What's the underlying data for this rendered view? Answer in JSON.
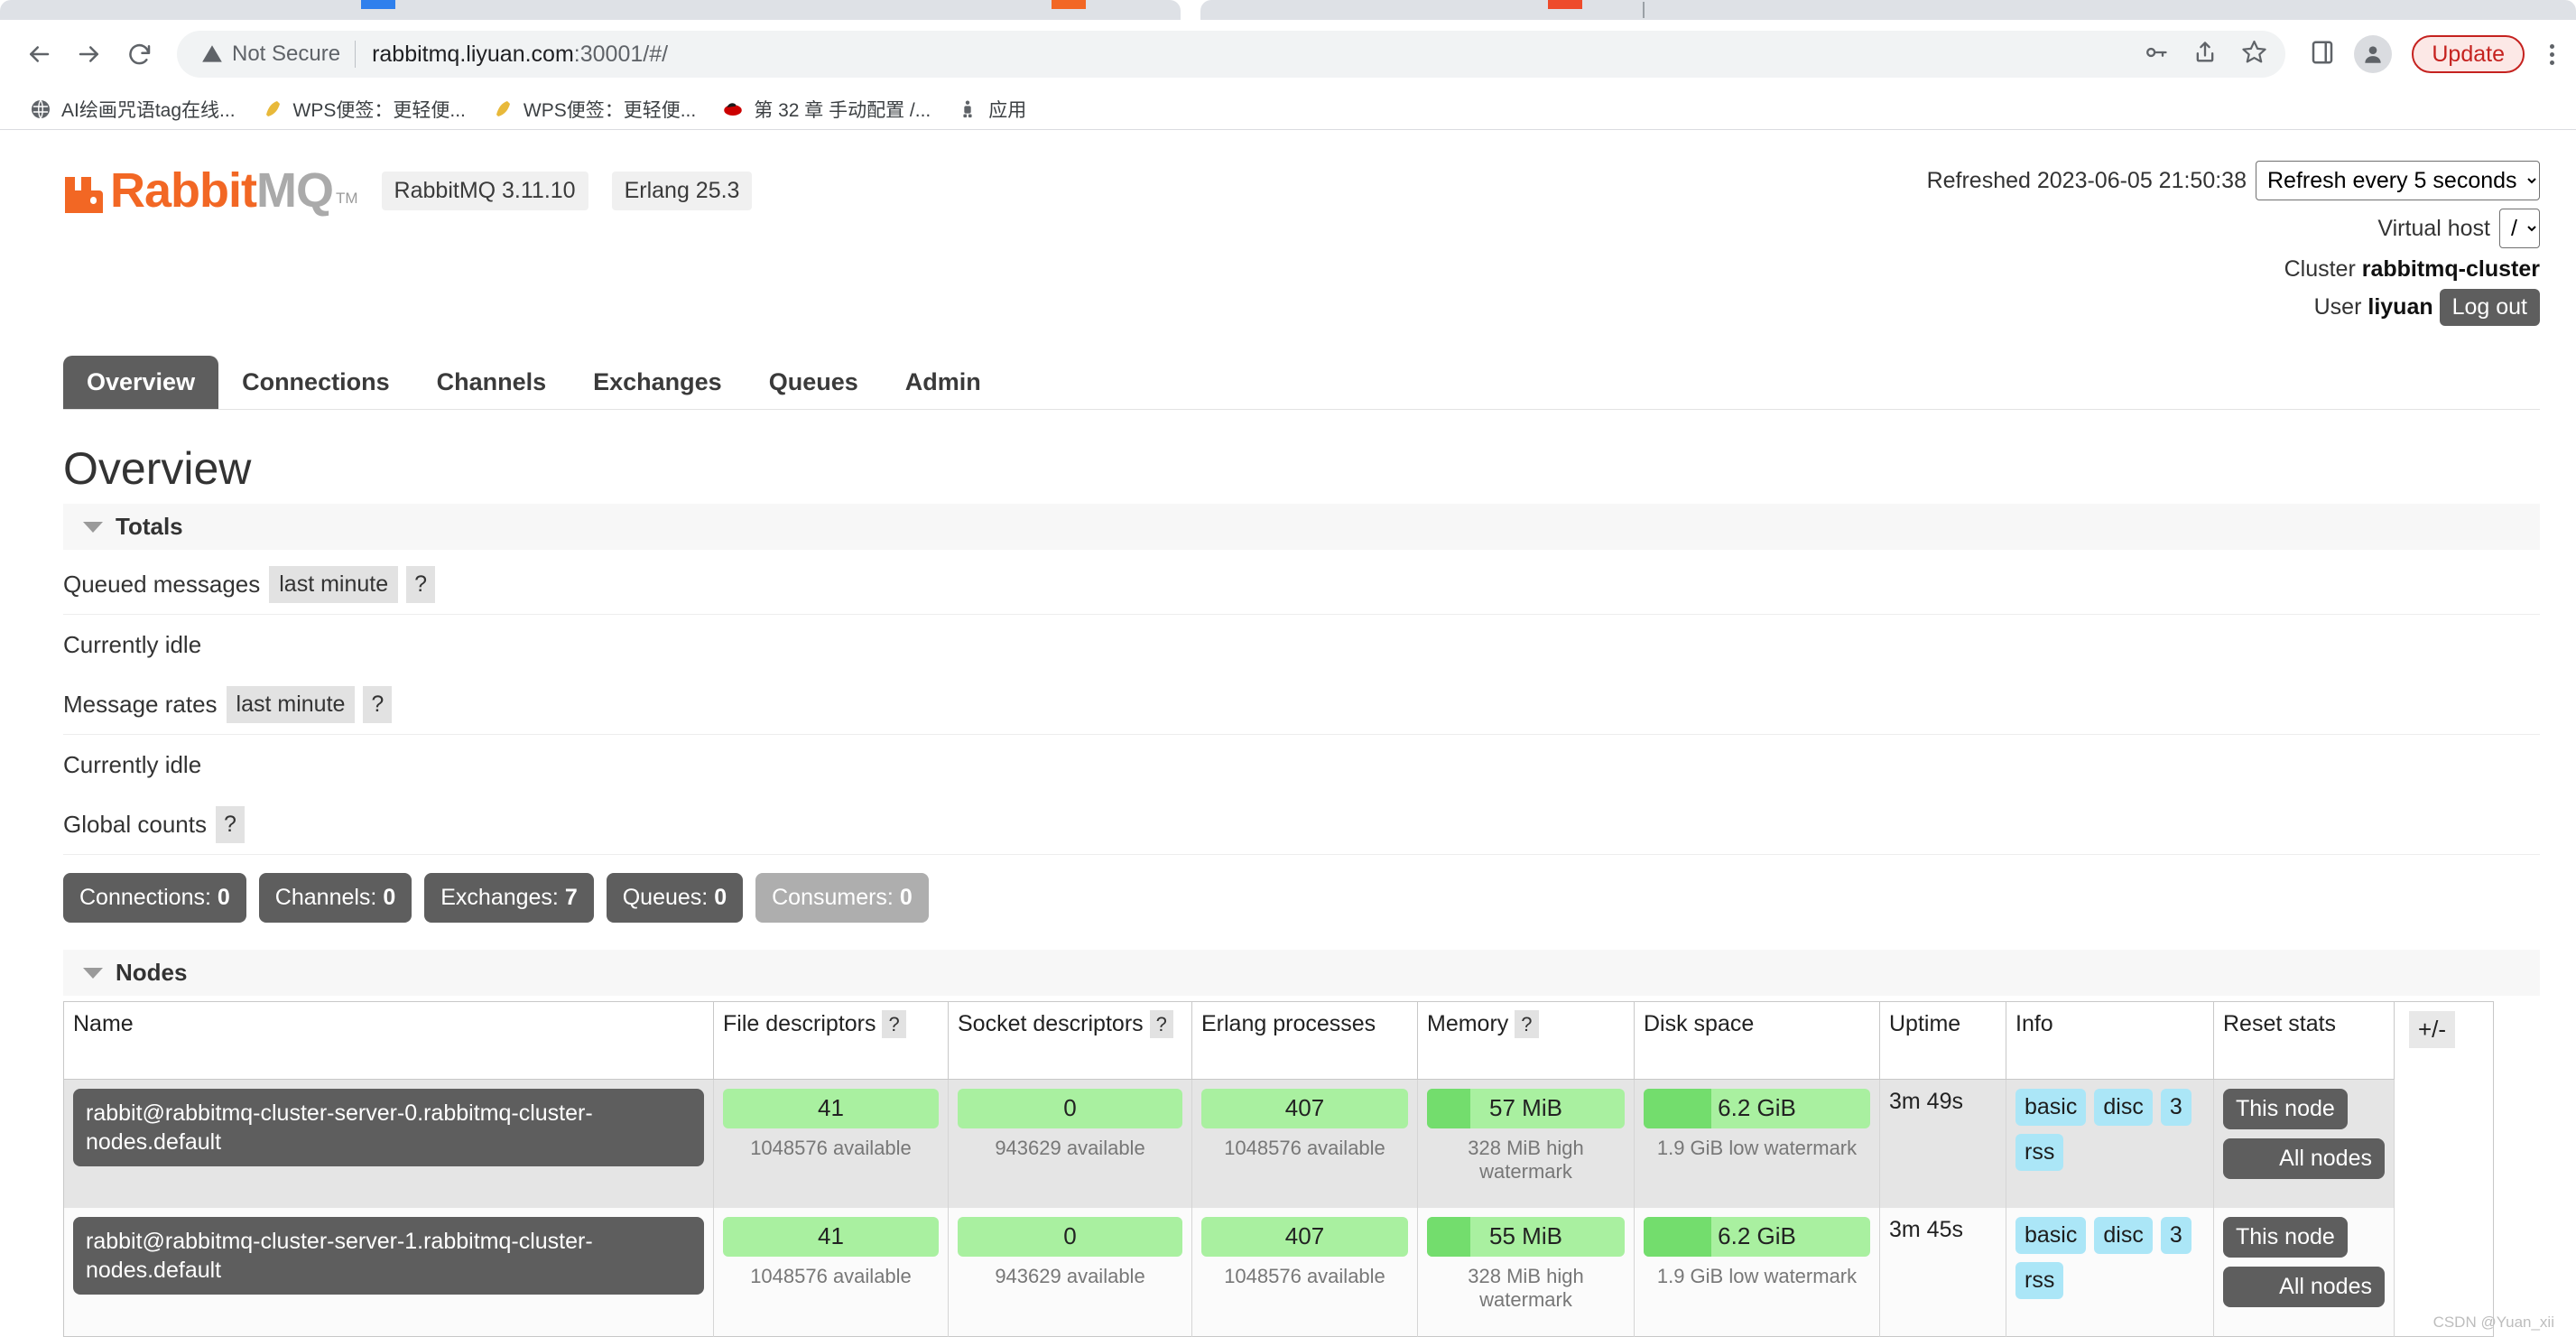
{
  "browser": {
    "back_icon": "back-arrow-icon",
    "forward_icon": "forward-arrow-icon",
    "reload_icon": "reload-icon",
    "security_label": "Not Secure",
    "url": "rabbitmq.liyuan.com:30001/#/",
    "url_host": "rabbitmq.liyuan.com",
    "url_rest": ":30001/#/",
    "update_label": "Update",
    "bookmarks": [
      {
        "label": "AI绘画咒语tag在线...",
        "icon": "globe-icon"
      },
      {
        "label": "WPS便签：更轻便...",
        "icon": "feather-icon"
      },
      {
        "label": "WPS便签：更轻便...",
        "icon": "feather-icon"
      },
      {
        "label": "第 32 章 手动配置 /...",
        "icon": "redhat-icon"
      },
      {
        "label": "应用",
        "icon": "apps-icon"
      }
    ]
  },
  "header": {
    "logo_rabbit": "Rabbit",
    "logo_mq": "MQ",
    "logo_tm": "TM",
    "version_pill": "RabbitMQ 3.11.10",
    "erlang_pill": "Erlang 25.3",
    "refreshed_label": "Refreshed 2023-06-05 21:50:38",
    "refresh_select_value": "Refresh every 5 seconds",
    "refresh_options": [
      "Refresh every 5 seconds"
    ],
    "vhost_label": "Virtual host",
    "vhost_value": "/",
    "vhost_options": [
      "/"
    ],
    "cluster_label": "Cluster",
    "cluster_name": "rabbitmq-cluster",
    "user_label": "User",
    "user_name": "liyuan",
    "logout_label": "Log out"
  },
  "nav": {
    "tabs": [
      {
        "label": "Overview",
        "active": true
      },
      {
        "label": "Connections",
        "active": false
      },
      {
        "label": "Channels",
        "active": false
      },
      {
        "label": "Exchanges",
        "active": false
      },
      {
        "label": "Queues",
        "active": false
      },
      {
        "label": "Admin",
        "active": false
      }
    ]
  },
  "main": {
    "page_title": "Overview",
    "totals": {
      "section_label": "Totals",
      "queued_messages_label": "Queued messages",
      "queued_messages_period": "last minute",
      "queued_messages_help": "?",
      "queued_messages_status": "Currently idle",
      "message_rates_label": "Message rates",
      "message_rates_period": "last minute",
      "message_rates_help": "?",
      "message_rates_status": "Currently idle",
      "global_counts_label": "Global counts",
      "global_counts_help": "?",
      "counts": [
        {
          "label": "Connections:",
          "value": "0",
          "disabled": false
        },
        {
          "label": "Channels:",
          "value": "0",
          "disabled": false
        },
        {
          "label": "Exchanges:",
          "value": "7",
          "disabled": false
        },
        {
          "label": "Queues:",
          "value": "0",
          "disabled": false
        },
        {
          "label": "Consumers:",
          "value": "0",
          "disabled": true
        }
      ]
    },
    "nodes": {
      "section_label": "Nodes",
      "columns": [
        "Name",
        "File descriptors",
        "Socket descriptors",
        "Erlang processes",
        "Memory",
        "Disk space",
        "Uptime",
        "Info",
        "Reset stats"
      ],
      "col_help": {
        "file_descriptors": "?",
        "socket_descriptors": "?",
        "memory": "?"
      },
      "plusminus_label": "+/-",
      "rows": [
        {
          "name": "rabbit@rabbitmq-cluster-server-0.rabbitmq-cluster-nodes.default",
          "file_descriptors": {
            "value": "41",
            "sub": "1048576 available",
            "fill_pct": 0
          },
          "socket_descriptors": {
            "value": "0",
            "sub": "943629 available",
            "fill_pct": 0
          },
          "erlang_processes": {
            "value": "407",
            "sub": "1048576 available",
            "fill_pct": 0
          },
          "memory": {
            "value": "57 MiB",
            "sub": "328 MiB high watermark",
            "fill_pct": 22
          },
          "disk_space": {
            "value": "6.2 GiB",
            "sub": "1.9 GiB low watermark",
            "fill_pct": 30
          },
          "uptime": "3m 49s",
          "info_tags": [
            "basic",
            "disc",
            "3",
            "rss"
          ],
          "reset_this": "This node",
          "reset_all": "All nodes"
        },
        {
          "name": "rabbit@rabbitmq-cluster-server-1.rabbitmq-cluster-nodes.default",
          "file_descriptors": {
            "value": "41",
            "sub": "1048576 available",
            "fill_pct": 0
          },
          "socket_descriptors": {
            "value": "0",
            "sub": "943629 available",
            "fill_pct": 0
          },
          "erlang_processes": {
            "value": "407",
            "sub": "1048576 available",
            "fill_pct": 0
          },
          "memory": {
            "value": "55 MiB",
            "sub": "328 MiB high watermark",
            "fill_pct": 22
          },
          "disk_space": {
            "value": "6.2 GiB",
            "sub": "1.9 GiB low watermark",
            "fill_pct": 30
          },
          "uptime": "3m 45s",
          "info_tags": [
            "basic",
            "disc",
            "3",
            "rss"
          ],
          "reset_this": "This node",
          "reset_all": "All nodes"
        }
      ]
    }
  },
  "watermark": "CSDN @Yuan_xii",
  "colors": {
    "brand_orange": "#f26724",
    "dark_gray": "#5e5e5e",
    "bar_light_green": "#a9f0a0",
    "bar_dark_green": "#73dd6d",
    "tag_blue": "#abe6f7"
  }
}
